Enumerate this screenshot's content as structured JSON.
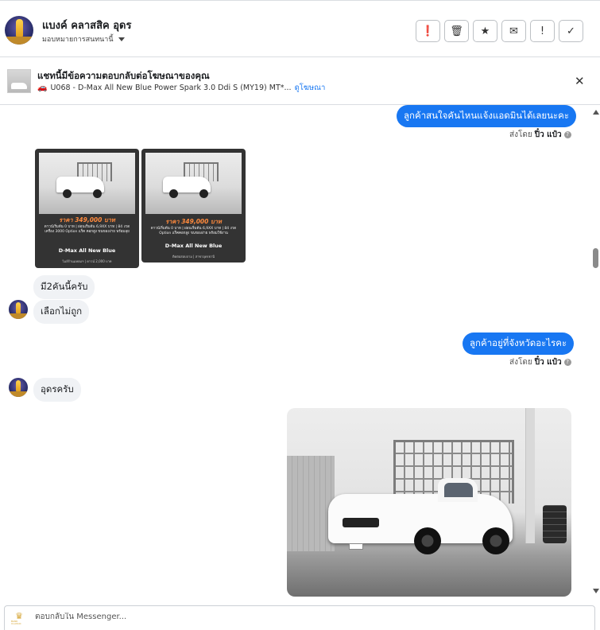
{
  "header": {
    "page_name": "แบงค์ คลาสสิค อุดร",
    "assign_label": "มอบหมายการสนทนานี้",
    "toolbar": [
      {
        "name": "report-button",
        "glyph": "❗",
        "icon": "alert-circle-icon"
      },
      {
        "name": "delete-button",
        "glyph": "🗑",
        "icon": "trash-icon"
      },
      {
        "name": "star-button",
        "glyph": "★",
        "icon": "star-icon"
      },
      {
        "name": "mark-unread-button",
        "glyph": "✉",
        "icon": "envelope-icon"
      },
      {
        "name": "spam-button",
        "glyph": "!",
        "icon": "exclamation-icon"
      },
      {
        "name": "done-button",
        "glyph": "✓",
        "icon": "check-icon"
      }
    ]
  },
  "ad": {
    "title": "แชทนี้มีข้อความตอบกลับต่อโฆษณาของคุณ",
    "subtitle": "U068 - D-Max All New Blue Power Spark 3.0 Ddi S (MY19) MT*...",
    "link": "ดูโฆษณา",
    "close": "✕"
  },
  "messages": {
    "out1": "ลูกค้าสนใจคันไหนแจ้งแอดมินได้เลยนะคะ",
    "sentby_label": "ส่งโดย",
    "sender": "ปิ๋ว แป๋ว",
    "in1": "มี2คันนี้ครับ",
    "in2": "เลือกไม่ถูก",
    "out2": "ลูกค้าอยู่ที่จังหวัดอะไรคะ",
    "in3": "อุดรครับ"
  },
  "flyers": [
    {
      "price": "ราคา 349,000 บาท",
      "fine": "ดาวน์เริ่มต้น 0 บาท | ผ่อนเริ่มต้น 6,9XX บาท | 84 งวด เครื่อง 3000 Option แร็ค คอกสูง ขนของง่าย พร้อมลุย",
      "model": "D-Max All New Blue",
      "foot": "ไมล์ร้านแหลมฯ | ดาวน์ 2,000 บาท"
    },
    {
      "price": "ราคา 349,000 บาท",
      "fine": "ดาวน์เริ่มต้น 0 บาท | ผ่อนเริ่มต้น 6,9XX บาท | 84 งวด Option แร็คคอกสูง ขนของง่าย พร้อมใช้งาน",
      "model": "D-Max All New Blue",
      "foot": "ติดต่อสอบถาม | สาขาอุดรธานี"
    }
  ],
  "reply": {
    "placeholder": "ตอบกลับใน Messenger...",
    "brand_mark": "BANK CLASSIC"
  },
  "colors": {
    "accent": "#1877f2",
    "incoming_bubble": "#f0f2f5"
  }
}
